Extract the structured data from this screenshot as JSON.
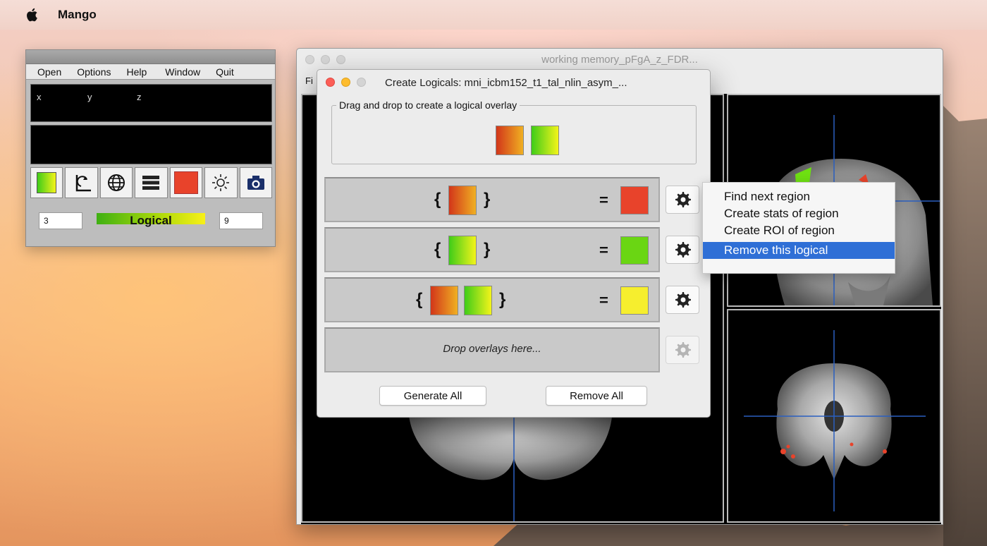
{
  "menubar": {
    "app_name": "Mango"
  },
  "toolbox": {
    "menu": [
      "Open",
      "Options",
      "Help",
      "Window",
      "Quit"
    ],
    "coords": {
      "x": "x",
      "y": "y",
      "z": "z"
    },
    "min_value": "3",
    "max_value": "9",
    "lut_label": "Logical",
    "tool_icons": [
      "lut-gradient-icon",
      "crosshair-reset-icon",
      "globe-icon",
      "layers-icon",
      "color-swatch-icon",
      "brightness-icon",
      "camera-icon"
    ]
  },
  "viewer": {
    "title": "working memory_pFgA_z_FDR...",
    "menu_first": "Fi"
  },
  "dialog": {
    "title": "Create Logicals: mni_icbm152_t1_tal_nlin_asym_...",
    "dropzone_label": "Drag and drop to create a logical overlay",
    "row_brace_open": "{",
    "row_brace_close": "}",
    "row_equals": "=",
    "drop_hint": "Drop overlays here...",
    "generate_all": "Generate All",
    "remove_all": "Remove All"
  },
  "colors": {
    "result_red": "#e8432b",
    "result_green": "#6ad613",
    "result_yellow": "#f6ee2e",
    "menu_highlight": "#2f6fd6"
  },
  "context_menu": {
    "items": [
      "Find next region",
      "Create stats of region",
      "Create ROI of region",
      "Remove this logical"
    ],
    "highlighted": "Remove this logical"
  }
}
